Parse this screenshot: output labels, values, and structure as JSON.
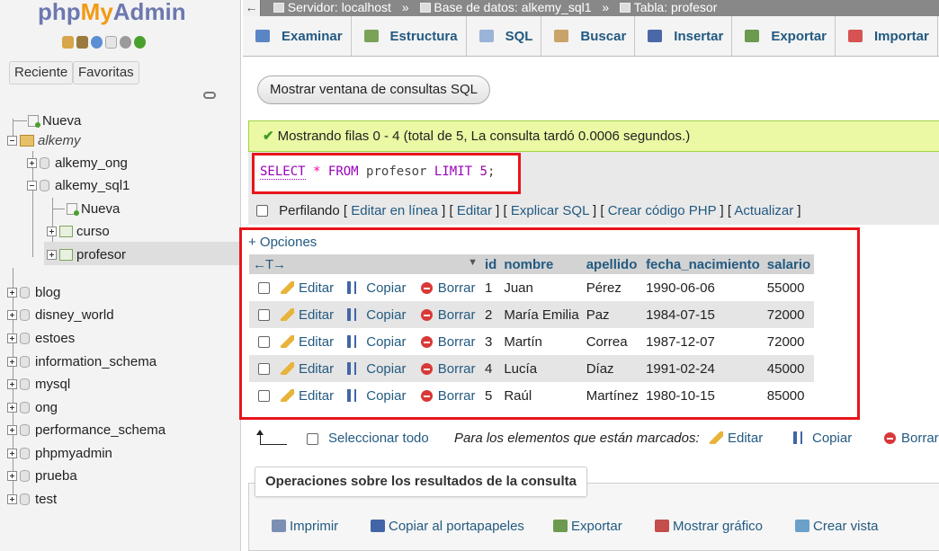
{
  "sidebar": {
    "logo_php": "php",
    "logo_my": "My",
    "logo_admin": "Admin",
    "quick_icons": [
      "home-icon",
      "exit-icon",
      "help-icon",
      "docs-icon",
      "settings-icon",
      "reload-icon"
    ],
    "btn_recent": "Reciente",
    "btn_favorites": "Favoritas",
    "tree": {
      "nueva_root": "Nueva",
      "group_alkemy": "alkemy",
      "alkemy_ong": "alkemy_ong",
      "alkemy_sql1": "alkemy_sql1",
      "nueva_sql1": "Nueva",
      "curso": "curso",
      "profesor": "profesor",
      "databases": [
        "blog",
        "disney_world",
        "estoes",
        "information_schema",
        "mysql",
        "ong",
        "performance_schema",
        "phpmyadmin",
        "prueba",
        "test"
      ]
    }
  },
  "breadcrumb": {
    "back": "←",
    "server": "Servidor: localhost",
    "database": "Base de datos: alkemy_sql1",
    "table": "Tabla: profesor",
    "separator": "»"
  },
  "tabs": [
    {
      "label": "Examinar",
      "icon": "browse-icon",
      "color": "#5b86c6"
    },
    {
      "label": "Estructura",
      "icon": "structure-icon",
      "color": "#7aa357"
    },
    {
      "label": "SQL",
      "icon": "sql-icon",
      "color": "#9bb3d6"
    },
    {
      "label": "Buscar",
      "icon": "search-icon",
      "color": "#c9a46a"
    },
    {
      "label": "Insertar",
      "icon": "insert-icon",
      "color": "#4a67a8"
    },
    {
      "label": "Exportar",
      "icon": "export-icon",
      "color": "#6c9a4f"
    },
    {
      "label": "Importar",
      "icon": "import-icon",
      "color": "#d75353"
    }
  ],
  "sql_window_button": "Mostrar ventana de consultas SQL",
  "success_message": "Mostrando filas 0 - 4 (total de 5, La consulta tardó 0.0006 segundos.)",
  "sql_query": {
    "select": "SELECT",
    "star": "*",
    "from": "FROM",
    "table": "profesor",
    "limit": "LIMIT",
    "limit_value": "5",
    "end": ";"
  },
  "profiling": {
    "label": "Perfilando",
    "links": [
      "Editar en línea",
      "Editar",
      "Explicar SQL",
      "Crear código PHP",
      "Actualizar"
    ]
  },
  "options_link": "+ Opciones",
  "table": {
    "sort_arrows": "←T→",
    "columns": [
      "id",
      "nombre",
      "apellido",
      "fecha_nacimiento",
      "salario"
    ],
    "actions": {
      "edit": "Editar",
      "copy": "Copiar",
      "delete": "Borrar"
    },
    "rows": [
      [
        "1",
        "Juan",
        "Pérez",
        "1990-06-06",
        "55000"
      ],
      [
        "2",
        "María Emilia",
        "Paz",
        "1984-07-15",
        "72000"
      ],
      [
        "3",
        "Martín",
        "Correa",
        "1987-12-07",
        "72000"
      ],
      [
        "4",
        "Lucía",
        "Díaz",
        "1991-02-24",
        "45000"
      ],
      [
        "5",
        "Raúl",
        "Martínez",
        "1980-10-15",
        "85000"
      ]
    ]
  },
  "bulk": {
    "select_all": "Seleccionar todo",
    "marked_label": "Para los elementos que están marcados:",
    "edit": "Editar",
    "copy": "Copiar",
    "delete": "Borrar"
  },
  "operations": {
    "title": "Operaciones sobre los resultados de la consulta",
    "items": [
      "Imprimir",
      "Copiar al portapapeles",
      "Exportar",
      "Mostrar gráfico",
      "Crear vista"
    ]
  },
  "colors": {
    "link": "#235a81",
    "success_bg": "#ebf8a4",
    "highlight_red": "#e8141b",
    "breadcrumb_bg": "#888888"
  }
}
